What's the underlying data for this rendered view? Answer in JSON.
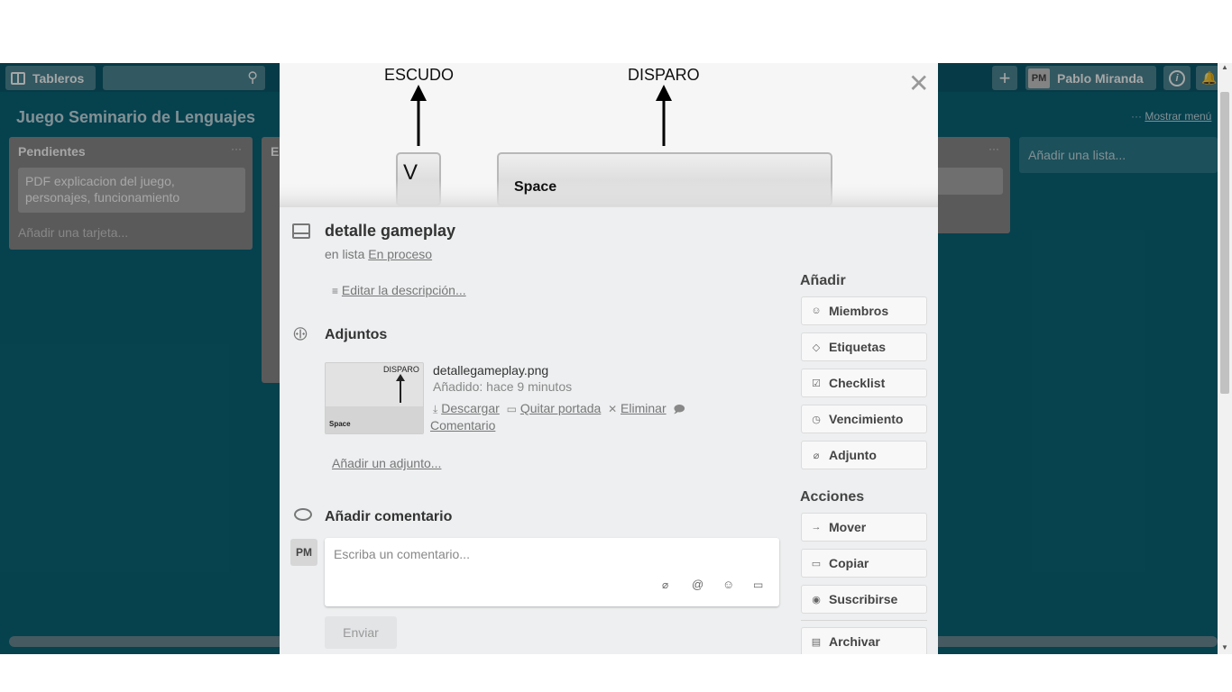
{
  "header": {
    "boards_label": "Tableros",
    "user_initials": "PM",
    "user_name": "Pablo Miranda"
  },
  "board": {
    "title": "Juego Seminario de Lenguajes",
    "show_menu": "Mostrar menú",
    "lists": [
      {
        "title": "Pendientes",
        "cards": [
          "PDF explicacion del juego, personajes, funcionamiento"
        ],
        "add_card": "Añadir una tarjeta..."
      },
      {
        "title": "E",
        "cards": []
      }
    ],
    "add_list": "Añadir una lista..."
  },
  "modal": {
    "cover": {
      "label_shield": "ESCUDO",
      "label_shoot": "DISPARO",
      "key_v": "V",
      "key_space": "Space"
    },
    "card_title": "detalle gameplay",
    "in_list_prefix": "en lista",
    "list_name": "En proceso",
    "edit_description": "Editar la descripción...",
    "attachments_heading": "Adjuntos",
    "attachment": {
      "thumb_label_shoot": "DISPARO",
      "thumb_label_space": "Space",
      "filename": "detallegameplay.png",
      "added": "Añadido: hace 9 minutos",
      "download": "Descargar",
      "remove_cover": "Quitar portada",
      "delete": "Eliminar",
      "comment": "Comentario"
    },
    "add_attachment": "Añadir un adjunto...",
    "comment_heading": "Añadir comentario",
    "comment_avatar": "PM",
    "comment_placeholder": "Escriba un comentario...",
    "send_button": "Enviar",
    "add_heading": "Añadir",
    "add_buttons": [
      "Miembros",
      "Etiquetas",
      "Checklist",
      "Vencimiento",
      "Adjunto"
    ],
    "actions_heading": "Acciones",
    "action_buttons": [
      "Mover",
      "Copiar",
      "Suscribirse",
      "Archivar"
    ]
  }
}
